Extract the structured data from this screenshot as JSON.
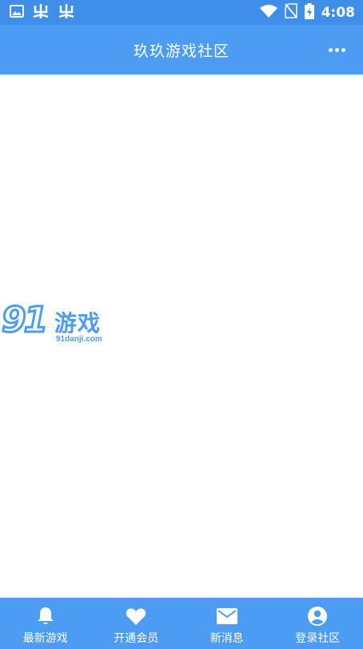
{
  "status_bar": {
    "time": "4:08",
    "icons": [
      "image-icon",
      "bug-icon",
      "bug-icon",
      "wifi-icon",
      "no-sim-icon",
      "battery-charging-icon"
    ]
  },
  "app_bar": {
    "title": "玖玖游戏社区",
    "menu_icon": "more-dots-icon"
  },
  "watermark": {
    "brand_number": "91",
    "brand_text": "游戏",
    "url": "91danji.com"
  },
  "bottom_nav": {
    "items": [
      {
        "label": "最新游戏",
        "icon": "bell-icon"
      },
      {
        "label": "开通会员",
        "icon": "heart-icon"
      },
      {
        "label": "新消息",
        "icon": "mail-icon"
      },
      {
        "label": "登录社区",
        "icon": "user-circle-icon"
      }
    ]
  },
  "colors": {
    "status_bar": "#3f8fea",
    "app_bar": "#4d9cf4",
    "bottom_nav": "#4d9cf4",
    "background": "#ffffff"
  }
}
